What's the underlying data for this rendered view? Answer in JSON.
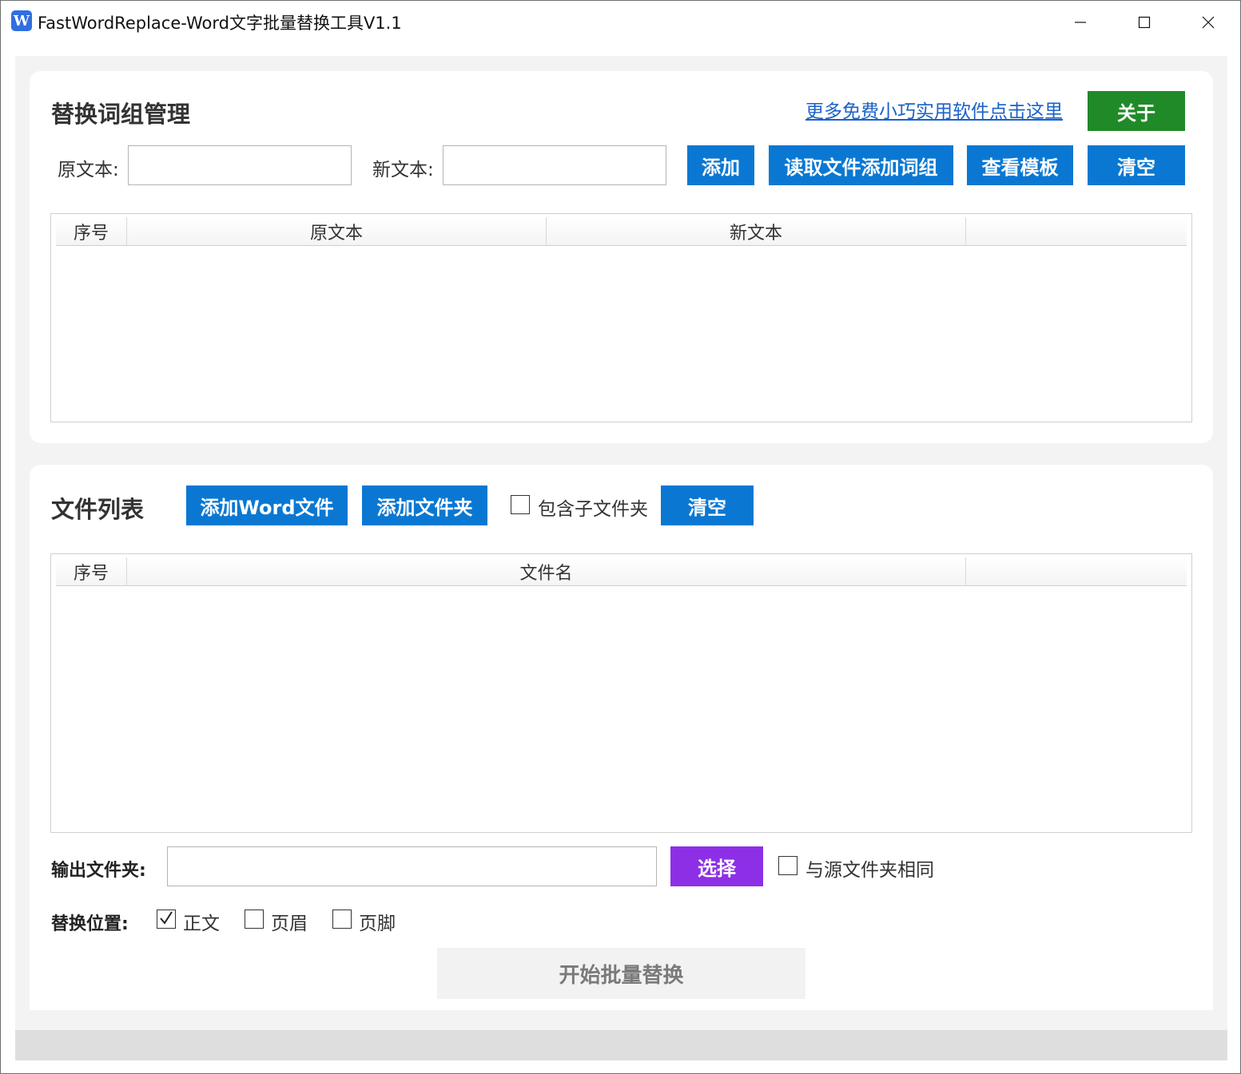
{
  "window": {
    "icon_letter": "W",
    "title": "FastWordReplace-Word文字批量替换工具V1.1"
  },
  "phrases": {
    "heading": "替换词组管理",
    "more_link": "更多免费小巧实用软件点击这里",
    "about_label": "关于",
    "original_label": "原文本:",
    "original_value": "",
    "new_label": "新文本:",
    "new_value": "",
    "add_label": "添加",
    "load_file_label": "读取文件添加词组",
    "view_template_label": "查看模板",
    "clear_label": "清空",
    "columns": [
      "序号",
      "原文本",
      "新文本",
      ""
    ],
    "rows": []
  },
  "files": {
    "heading": "文件列表",
    "add_word_label": "添加Word文件",
    "add_folder_label": "添加文件夹",
    "include_subfolders_label": "包含子文件夹",
    "include_subfolders_checked": false,
    "clear_label": "清空",
    "columns": [
      "序号",
      "文件名",
      ""
    ],
    "rows": []
  },
  "output": {
    "label": "输出文件夹:",
    "value": "",
    "select_label": "选择",
    "same_as_source_label": "与源文件夹相同",
    "same_as_source_checked": false
  },
  "position": {
    "label": "替换位置:",
    "options": [
      {
        "label": "正文",
        "checked": true
      },
      {
        "label": "页眉",
        "checked": false
      },
      {
        "label": "页脚",
        "checked": false
      }
    ]
  },
  "start_label": "开始批量替换",
  "colors": {
    "blue_button": "#0a78d2",
    "green_button": "#208a28",
    "purple_button": "#8d2fe6",
    "link": "#1a62c7"
  }
}
